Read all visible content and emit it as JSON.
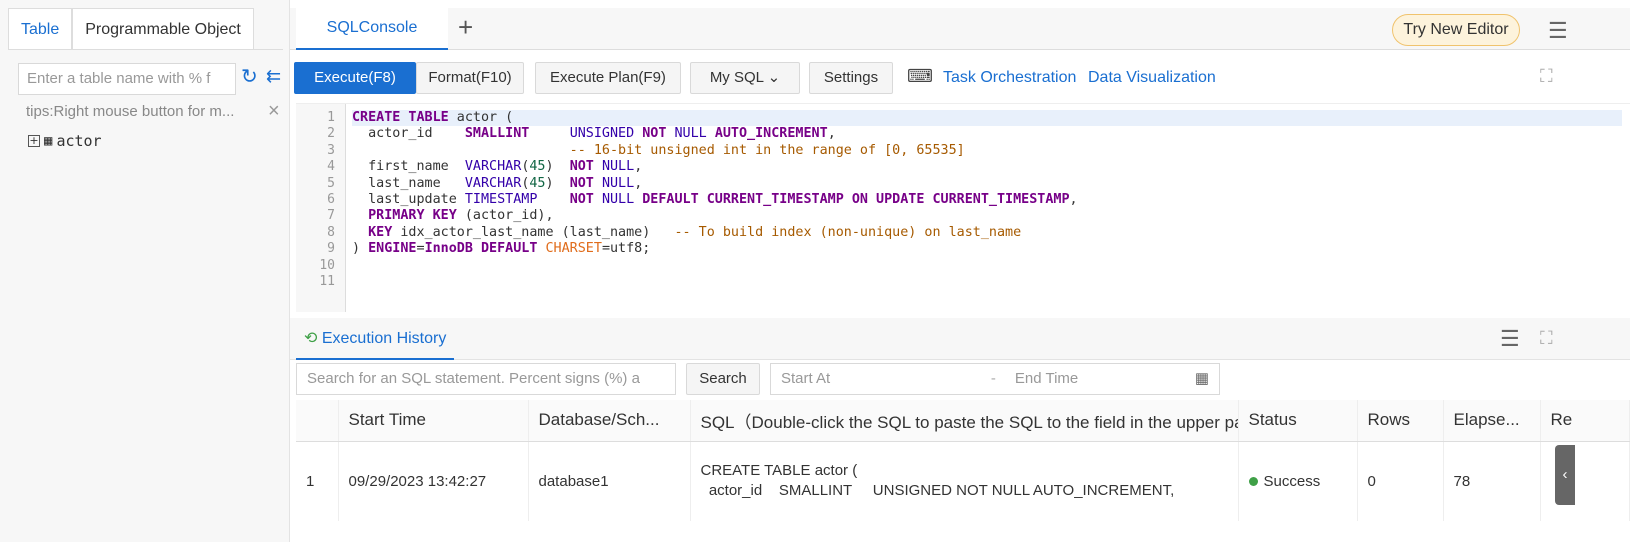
{
  "left_panel": {
    "tabs": [
      {
        "label": "Table",
        "active": true
      },
      {
        "label": "Programmable Object",
        "active": false
      }
    ],
    "search_placeholder": "Enter a table name with % f",
    "tips": "tips:Right mouse button for m...",
    "tree": [
      {
        "label": "actor",
        "icon": "table-icon"
      }
    ]
  },
  "header": {
    "tab": "SQLConsole",
    "try_new_editor": "Try New Editor"
  },
  "toolbar": {
    "execute": "Execute(F8)",
    "format": "Format(F10)",
    "plan": "Execute Plan(F9)",
    "db_type": "My SQL",
    "settings": "Settings",
    "task": "Task Orchestration",
    "viz": "Data Visualization"
  },
  "editor": {
    "lines": [
      [
        [
          "CREATE TABLE",
          "kw"
        ],
        [
          " actor (",
          ""
        ]
      ],
      [
        [
          "  actor_id    ",
          ""
        ],
        [
          "SMALLINT",
          "kw"
        ],
        [
          "     ",
          ""
        ],
        [
          "UNSIGNED",
          "ty"
        ],
        [
          " ",
          ""
        ],
        [
          "NOT",
          "kw"
        ],
        [
          " ",
          ""
        ],
        [
          "NULL",
          "ty"
        ],
        [
          " ",
          ""
        ],
        [
          "AUTO_INCREMENT",
          "kw"
        ],
        [
          ",",
          ""
        ]
      ],
      [
        [
          "                           ",
          ""
        ],
        [
          "-- 16-bit unsigned int in the range of [0, 65535]",
          "cm"
        ]
      ],
      [
        [
          "  first_name  ",
          ""
        ],
        [
          "VARCHAR",
          "ty"
        ],
        [
          "(",
          ""
        ],
        [
          "45",
          "nu"
        ],
        [
          ")  ",
          ""
        ],
        [
          "NOT",
          "kw"
        ],
        [
          " ",
          ""
        ],
        [
          "NULL",
          "ty"
        ],
        [
          ",",
          ""
        ]
      ],
      [
        [
          "  last_name   ",
          ""
        ],
        [
          "VARCHAR",
          "ty"
        ],
        [
          "(",
          ""
        ],
        [
          "45",
          "nu"
        ],
        [
          ")  ",
          ""
        ],
        [
          "NOT",
          "kw"
        ],
        [
          " ",
          ""
        ],
        [
          "NULL",
          "ty"
        ],
        [
          ",",
          ""
        ]
      ],
      [
        [
          "  last_update ",
          ""
        ],
        [
          "TIMESTAMP",
          "ty"
        ],
        [
          "    ",
          ""
        ],
        [
          "NOT",
          "kw"
        ],
        [
          " ",
          ""
        ],
        [
          "NULL",
          "ty"
        ],
        [
          " ",
          ""
        ],
        [
          "DEFAULT CURRENT_TIMESTAMP ON UPDATE CURRENT_TIMESTAMP",
          "kw"
        ],
        [
          ",",
          ""
        ]
      ],
      [
        [
          "  ",
          ""
        ],
        [
          "PRIMARY KEY",
          "kw"
        ],
        [
          " (actor_id),",
          ""
        ]
      ],
      [
        [
          "  ",
          ""
        ],
        [
          "KEY",
          "kw"
        ],
        [
          " idx_actor_last_name (last_name)   ",
          ""
        ],
        [
          "-- To build index (non-unique) on last_name",
          "cm"
        ]
      ],
      [
        [
          ") ",
          ""
        ],
        [
          "ENGINE",
          "kw"
        ],
        [
          "=",
          ""
        ],
        [
          "InnoDB",
          "kw"
        ],
        [
          " ",
          ""
        ],
        [
          "DEFAULT",
          "kw"
        ],
        [
          " ",
          ""
        ],
        [
          "CHARSET",
          "or"
        ],
        [
          "=utf8;",
          ""
        ]
      ],
      [],
      []
    ]
  },
  "history": {
    "tab": "Execution History",
    "search_placeholder": "Search for an SQL statement. Percent signs (%) a",
    "search_button": "Search",
    "start_placeholder": "Start At",
    "end_placeholder": "End Time",
    "range_sep": "-",
    "columns": [
      "",
      "Start Time",
      "Database/Sch...",
      "SQL（Double-click the SQL to paste the SQL to the field in the upper par",
      "Status",
      "Rows",
      "Elapse...",
      "Re"
    ],
    "rows": [
      {
        "index": "1",
        "start_time": "09/29/2023 13:42:27",
        "database": "database1",
        "sql_line1": "CREATE TABLE actor (",
        "sql_line2": "  actor_id    SMALLINT     UNSIGNED NOT NULL AUTO_INCREMENT,",
        "status": "Success",
        "rows": "0",
        "elapsed": "78"
      }
    ]
  },
  "colors": {
    "accent": "#1a6fd1",
    "success": "#3fa047"
  }
}
